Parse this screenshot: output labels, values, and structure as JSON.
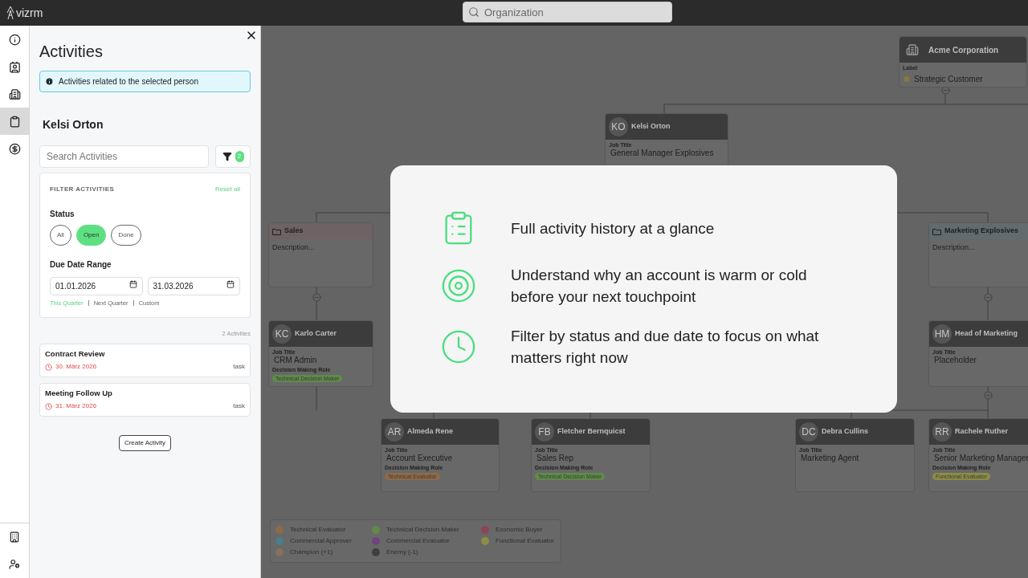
{
  "topbar": {
    "logo": "vizrm",
    "search": {
      "placeholder": "Organization"
    }
  },
  "rail": {
    "items": [
      {
        "selected": false
      },
      {
        "selected": false
      },
      {
        "selected": false
      },
      {
        "selected": true
      },
      {
        "selected": false
      }
    ]
  },
  "panel": {
    "title": "Activities",
    "info": "Activities related to the selected person",
    "person": "Kelsi Orton",
    "search": {
      "placeholder": "Search Activities"
    },
    "filter_count": "2",
    "filter": {
      "heading": "FILTER ACTIVITIES",
      "reset": "Reset all",
      "status_label": "Status",
      "statuses": [
        {
          "label": "All",
          "selected": false
        },
        {
          "label": "Open",
          "selected": true
        },
        {
          "label": "Done",
          "selected": false
        }
      ],
      "date_label": "Due Date Range",
      "date_from": "01.01.2026",
      "date_to": "31.03.2026",
      "ranges": [
        {
          "label": "This Quarter",
          "selected": true
        },
        {
          "label": "Next Quarter",
          "selected": false
        },
        {
          "label": "Custom",
          "selected": false
        }
      ]
    },
    "count": "2 Activities",
    "activities": [
      {
        "title": "Contract Review",
        "due": "30. März 2026",
        "overdue": true,
        "type": "task"
      },
      {
        "title": "Meeting Follow Up",
        "due": "31. März 2026",
        "overdue": true,
        "type": "task"
      }
    ],
    "create_button": "Create Activity"
  },
  "org_chart": {
    "nodes": [
      {
        "kind": "company",
        "name": "Acme Corporation",
        "label_caption": "Label",
        "label": "Strategic Customer"
      },
      {
        "kind": "person",
        "initials": "KO",
        "name": "Kelsi Orton",
        "job_caption": "Job Title",
        "job_title": "General Manager Explosives"
      },
      {
        "kind": "group",
        "name": "Sales",
        "description": "Description...",
        "color": "#6e6264"
      },
      {
        "kind": "group",
        "name": "Marketing Explosives",
        "description": "Description...",
        "color": "#626b6d"
      },
      {
        "kind": "person",
        "initials": "KC",
        "name": "Karlo Carter",
        "job_caption": "Job Title",
        "job_title": "CRM Admin",
        "role_caption": "Decision Making Role",
        "role": "Technical Decision Maker",
        "color": "#5f8a4a"
      },
      {
        "kind": "person",
        "initials": "HM",
        "name": "Head of Marketing",
        "job_caption": "Job Title",
        "job_title": "Placeholder"
      },
      {
        "kind": "person",
        "initials": "AR",
        "name": "Almeda Rene",
        "job_caption": "Job Title",
        "job_title": "Account Executive",
        "role_caption": "Decision Making Role",
        "role": "Technical Evaluator",
        "color": "#8f6a48"
      },
      {
        "kind": "person",
        "initials": "FB",
        "name": "Fletcher Bernquicst",
        "job_caption": "Job Title",
        "job_title": "Sales Rep",
        "role_caption": "Decision Making Role",
        "role": "Technical Decision Maker",
        "color": "#5f8a4a"
      },
      {
        "kind": "person",
        "initials": "DC",
        "name": "Debra Cullins",
        "job_caption": "Job Title",
        "job_title": "Marketing Agent"
      },
      {
        "kind": "person",
        "initials": "RR",
        "name": "Rachele Ruther",
        "job_caption": "Job Title",
        "job_title": "Senior Marketing Manager",
        "role_caption": "Decision Making Role",
        "role": "Functional Evaluator",
        "color": "#8c8c44"
      }
    ],
    "legend": [
      {
        "label": "Technical Evaluator",
        "color": "#8f6a48"
      },
      {
        "label": "Technical Decision Maker",
        "color": "#5f8a4a"
      },
      {
        "label": "Economic Buyer",
        "color": "#8e4456"
      },
      {
        "label": "Commercial Approver",
        "color": "#4a7e88"
      },
      {
        "label": "Commercial Evaluator",
        "color": "#704480"
      },
      {
        "label": "Functional Evaluator",
        "color": "#8c8c44"
      },
      {
        "label": "Champion (+1)",
        "color": "#86705f"
      },
      {
        "label": "Enemy (-1)",
        "color": "#3e3e3e"
      }
    ]
  },
  "modal": {
    "features": [
      {
        "text": "Full activity history at a glance"
      },
      {
        "text": "Understand why an account is warm or cold before your next touchpoint"
      },
      {
        "text": "Filter by status and due date to focus on what matters right now"
      }
    ]
  }
}
